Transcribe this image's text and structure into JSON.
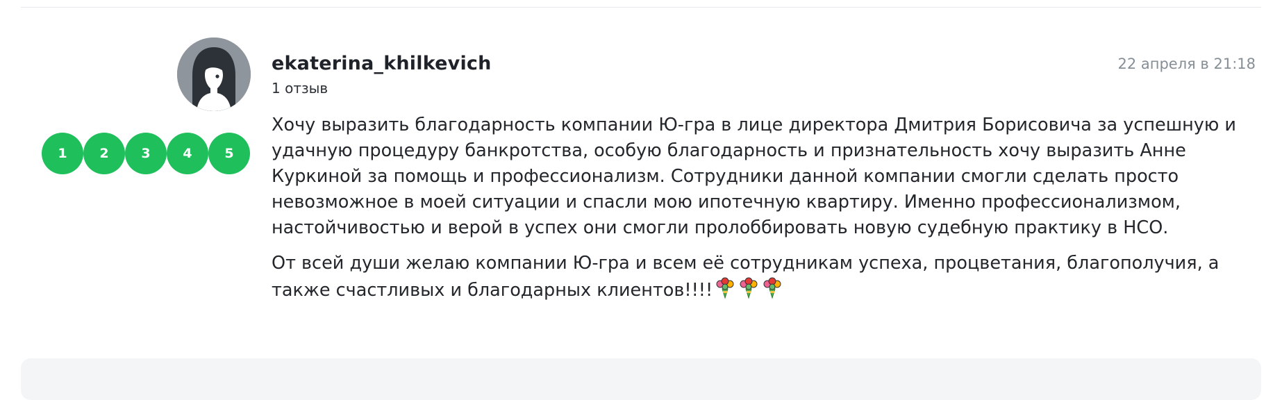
{
  "review": {
    "author": "ekaterina_khilkevich",
    "review_count": "1 отзыв",
    "date": "22 апреля в 21:18",
    "rating_labels": [
      "1",
      "2",
      "3",
      "4",
      "5"
    ],
    "paragraph_1": "Хочу выразить благодарность компании Ю-гра в лице директора Дмитрия Борисовича за успешную и удачную процедуру банкротства, особую благодарность и признательность хочу выразить Анне Куркиной за помощь и профессионализм. Сотрудники данной компании смогли сделать просто невозможное в моей ситуации и спасли мою ипотечную квартиру. Именно профессионализмом, настойчивостью и верой в успех они смогли пролоббировать новую судебную практику в НСО.",
    "paragraph_2": "От всей души желаю компании Ю-гра и всем её сотрудникам успеха, процветания, благополучия, а также счастливых и благодарных клиентов!!!!",
    "emoji_icons": [
      "bouquet-icon",
      "bouquet-icon",
      "bouquet-icon"
    ]
  },
  "colors": {
    "rating_green": "#1fbf5c",
    "date_gray": "#868e96",
    "avatar_bg": "#8e959c"
  }
}
